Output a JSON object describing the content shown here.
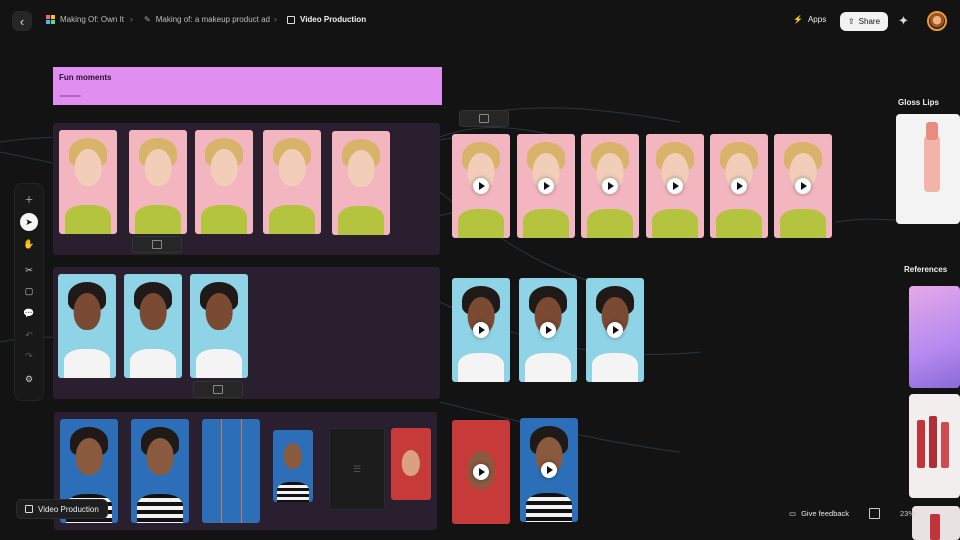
{
  "topbar": {
    "breadcrumbs": [
      {
        "label": "Making Of: Own It"
      },
      {
        "label": "Making of: a makeup product ad"
      },
      {
        "label": "Video Production"
      }
    ],
    "apps_label": "Apps",
    "share_label": "Share"
  },
  "canvas": {
    "banner_title": "Fun moments",
    "panel_gloss": "Gloss Lips",
    "panel_references": "References"
  },
  "bottom": {
    "chip_label": "Video Production",
    "feedback_label": "Give feedback",
    "zoom_label": "23%"
  },
  "colors": {
    "accent_pink": "#e08ef0",
    "group_bg": "#2a1f2f",
    "pink_backdrop": "#f3b6c0",
    "blue_backdrop": "#8fd3e6",
    "deep_blue": "#2c6fb8"
  },
  "icons": [
    "chevron-left-icon",
    "app-icon",
    "generate-icon",
    "video-icon",
    "bolt-icon",
    "share-icon",
    "sparkle-icon",
    "plus-icon",
    "cursor-icon",
    "hand-icon",
    "scissors-icon",
    "note-icon",
    "comment-icon",
    "undo-icon",
    "redo-icon",
    "settings-icon",
    "play-icon",
    "map-icon",
    "feedback-icon"
  ]
}
